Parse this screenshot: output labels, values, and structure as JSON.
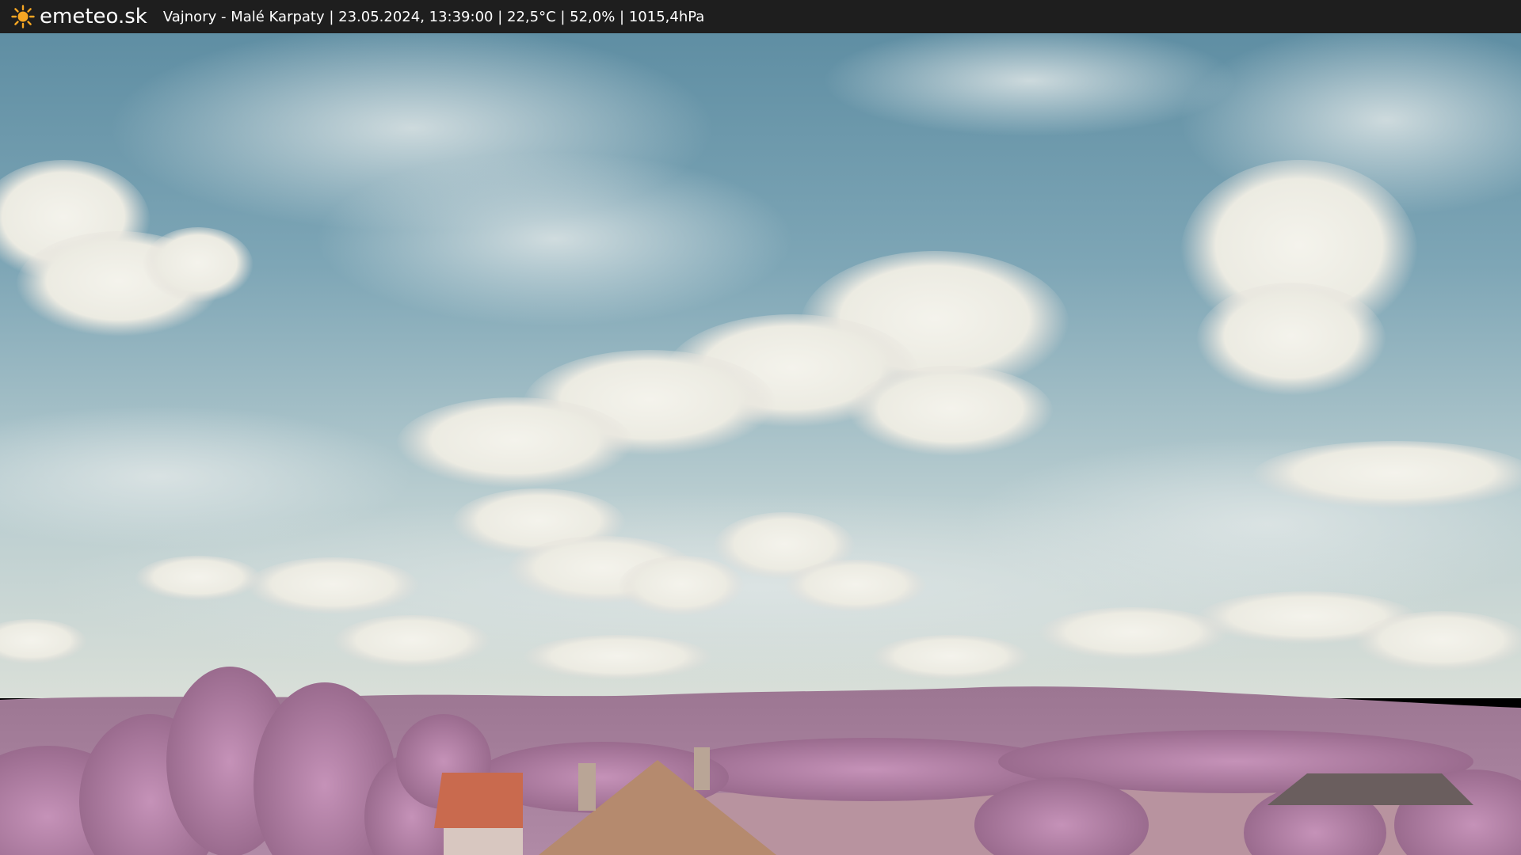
{
  "app": {
    "logo_text": "emeteo.sk",
    "logo_icon": "sun-icon"
  },
  "overlay": {
    "caption": "Vajnory - Malé Karpaty | 23.05.2024, 13:39:00 | 22,5°C | 52,0% | 1015,4hPa"
  },
  "colors": {
    "bar": "#1e1e1e",
    "sun": "#f5a623",
    "sky_top": "#5f8ea3",
    "cloud": "#eeeee6",
    "hills": "#a07896",
    "trees": "#b47ea6"
  }
}
